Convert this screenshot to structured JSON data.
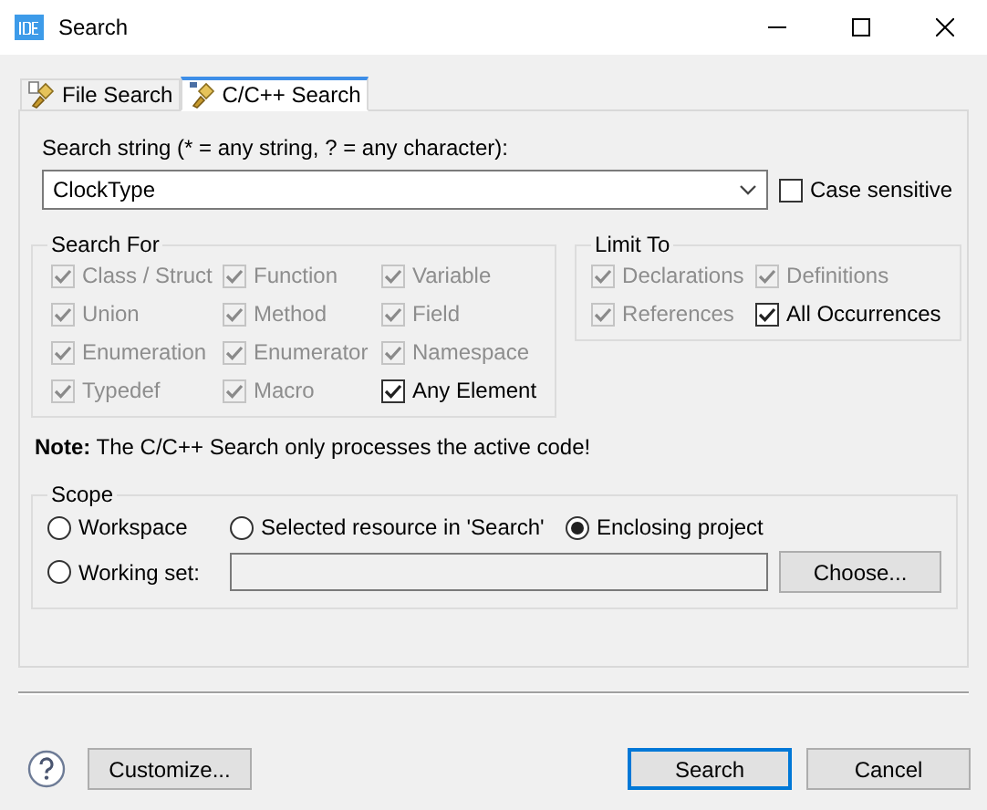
{
  "window": {
    "title": "Search"
  },
  "tabs": [
    {
      "label": "File Search",
      "selected": false
    },
    {
      "label": "C/C++ Search",
      "selected": true
    }
  ],
  "search_string": {
    "label": "Search string (* = any string, ? = any character):",
    "value": "ClockType"
  },
  "case_sensitive": {
    "label": "Case sensitive",
    "checked": false
  },
  "search_for": {
    "title": "Search For",
    "items": [
      {
        "label": "Class / Struct",
        "checked": true,
        "disabled": true
      },
      {
        "label": "Function",
        "checked": true,
        "disabled": true
      },
      {
        "label": "Variable",
        "checked": true,
        "disabled": true
      },
      {
        "label": "Union",
        "checked": true,
        "disabled": true
      },
      {
        "label": "Method",
        "checked": true,
        "disabled": true
      },
      {
        "label": "Field",
        "checked": true,
        "disabled": true
      },
      {
        "label": "Enumeration",
        "checked": true,
        "disabled": true
      },
      {
        "label": "Enumerator",
        "checked": true,
        "disabled": true
      },
      {
        "label": "Namespace",
        "checked": true,
        "disabled": true
      },
      {
        "label": "Typedef",
        "checked": true,
        "disabled": true
      },
      {
        "label": "Macro",
        "checked": true,
        "disabled": true
      },
      {
        "label": "Any Element",
        "checked": true,
        "disabled": false
      }
    ]
  },
  "limit_to": {
    "title": "Limit To",
    "items": [
      {
        "label": "Declarations",
        "checked": true,
        "disabled": true
      },
      {
        "label": "Definitions",
        "checked": true,
        "disabled": true
      },
      {
        "label": "References",
        "checked": true,
        "disabled": true
      },
      {
        "label": "All Occurrences",
        "checked": true,
        "disabled": false
      }
    ]
  },
  "note": "**Note:** The C/C++ Search only processes the active code!",
  "scope": {
    "title": "Scope",
    "options": [
      {
        "label": "Workspace",
        "selected": false
      },
      {
        "label": "Selected resource in 'Search'",
        "selected": false
      },
      {
        "label": "Enclosing project",
        "selected": true
      },
      {
        "label": "Working set:",
        "selected": false
      }
    ],
    "choose_button": "Choose..."
  },
  "buttons": {
    "customize": "Customize...",
    "search": "Search",
    "cancel": "Cancel"
  }
}
